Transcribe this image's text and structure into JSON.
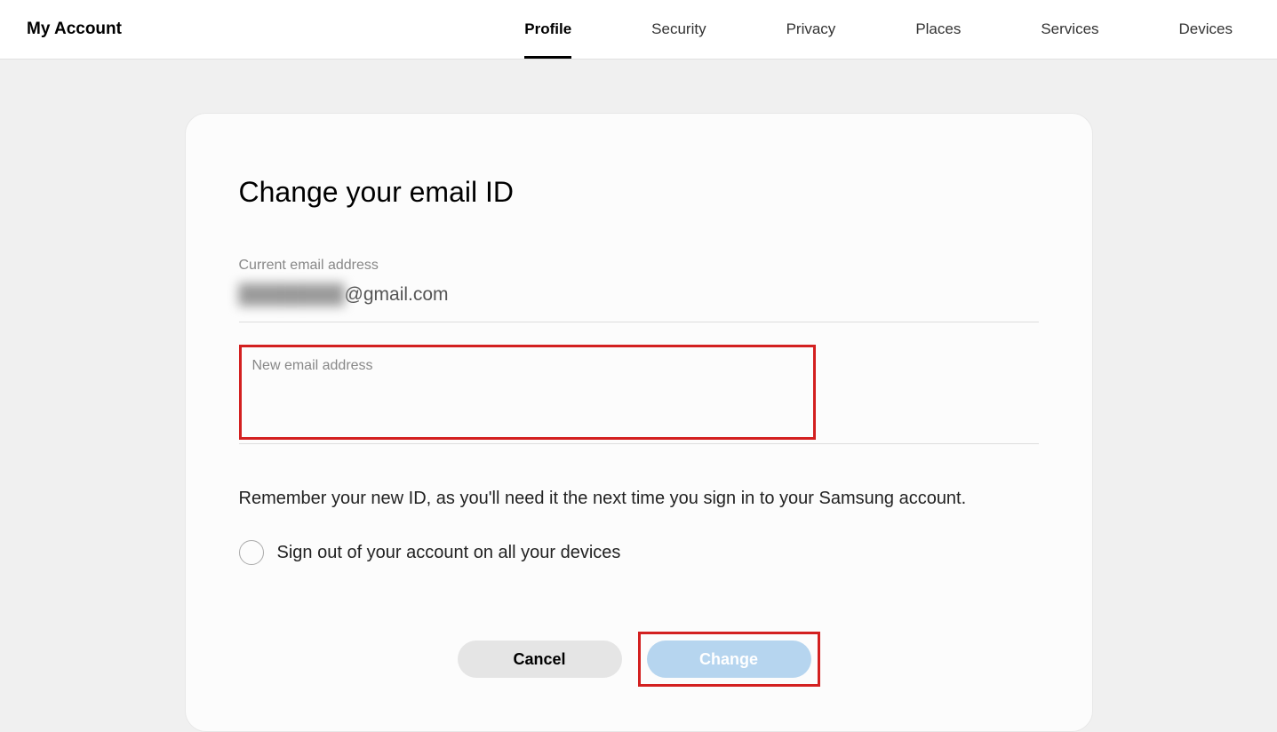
{
  "header": {
    "title": "My Account"
  },
  "nav": {
    "items": [
      {
        "label": "Profile",
        "active": true
      },
      {
        "label": "Security",
        "active": false
      },
      {
        "label": "Privacy",
        "active": false
      },
      {
        "label": "Places",
        "active": false
      },
      {
        "label": "Services",
        "active": false
      },
      {
        "label": "Devices",
        "active": false
      }
    ]
  },
  "card": {
    "title": "Change your email ID",
    "currentEmailLabel": "Current email address",
    "currentEmailHidden": "████████",
    "currentEmailVisible": "@gmail.com",
    "newEmailLabel": "New email address",
    "newEmailValue": "",
    "reminderText": "Remember your new ID, as you'll need it the next time you sign in to your Samsung account.",
    "signOutCheckbox": {
      "label": "Sign out of your account on all your devices",
      "checked": false
    },
    "buttons": {
      "cancel": "Cancel",
      "change": "Change"
    }
  }
}
